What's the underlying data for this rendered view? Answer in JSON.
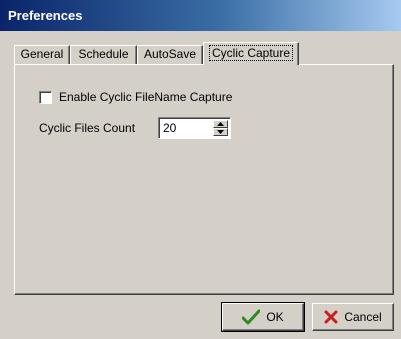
{
  "window": {
    "title": "Preferences"
  },
  "tabs": [
    {
      "label": "General",
      "active": false
    },
    {
      "label": "Schedule",
      "active": false
    },
    {
      "label": "AutoSave",
      "active": false
    },
    {
      "label": "Cyclic Capture",
      "active": true
    }
  ],
  "cyclic": {
    "enable_label": "Enable Cyclic FileName Capture",
    "enable_checked": false,
    "count_label": "Cyclic Files Count",
    "count_value": "20"
  },
  "buttons": {
    "ok_label": "OK",
    "ok_icon": "checkmark-icon",
    "cancel_label": "Cancel",
    "cancel_icon": "x-mark-icon"
  },
  "colors": {
    "title_gradient_start": "#0a246a",
    "title_gradient_end": "#a6caf0",
    "face": "#d4d0c8",
    "ok_green": "#2e8b1e",
    "cancel_red": "#c81e1e"
  }
}
